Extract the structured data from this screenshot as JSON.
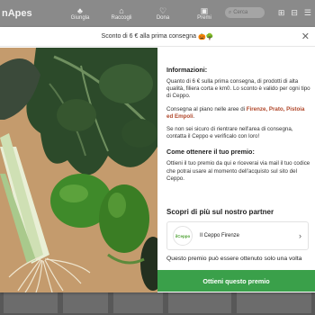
{
  "app": {
    "logo": "nApes",
    "nav": [
      {
        "label": "Giungla",
        "icon": "tree-icon"
      },
      {
        "label": "Raccogli",
        "icon": "basket-icon"
      },
      {
        "label": "Dona",
        "icon": "heart-icon"
      },
      {
        "label": "Premi",
        "icon": "gift-icon"
      }
    ],
    "search_placeholder": "Cerca"
  },
  "modal": {
    "banner_text": "Sconto di 6 € alla prima consegna",
    "banner_emoji": "🎃🌳",
    "close_label": "✕",
    "info_title": "Informazioni:",
    "info_p1": "Quanto di 6 € sulla prima consegna, di prodotti di alta qualità, filiera corta e km0. Lo sconto è valido per ogni tipo di Ceppo.",
    "info_p2_prefix": "Consegna al piano nelle aree di ",
    "info_p2_bold": "Firenze, Prato, Pistoia ed Empoli",
    "info_p2_suffix": ".",
    "info_p3": "Se non sei sicuro di rientrare nell'area di consegna, contatta il Ceppo e verificalo con loro!",
    "how_title": "Come ottenere il tuo premio:",
    "how_text": "Ottieni il tuo premio da qui e riceverai via mail il tuo codice che potrai usare al momento dell'acquisto sul sito del Ceppo.",
    "partner_heading": "Scopri di più sul nostro partner",
    "partner_logo_text": "ilCeppo",
    "partner_name": "Il Ceppo Firenze",
    "partner_arrow": "›",
    "once_text": "Questo premio può essere ottenuto solo una volta",
    "cta_label": "Ottieni questo premio"
  },
  "colors": {
    "cta": "#3aa04a",
    "partner_logo": "#4fa234"
  }
}
